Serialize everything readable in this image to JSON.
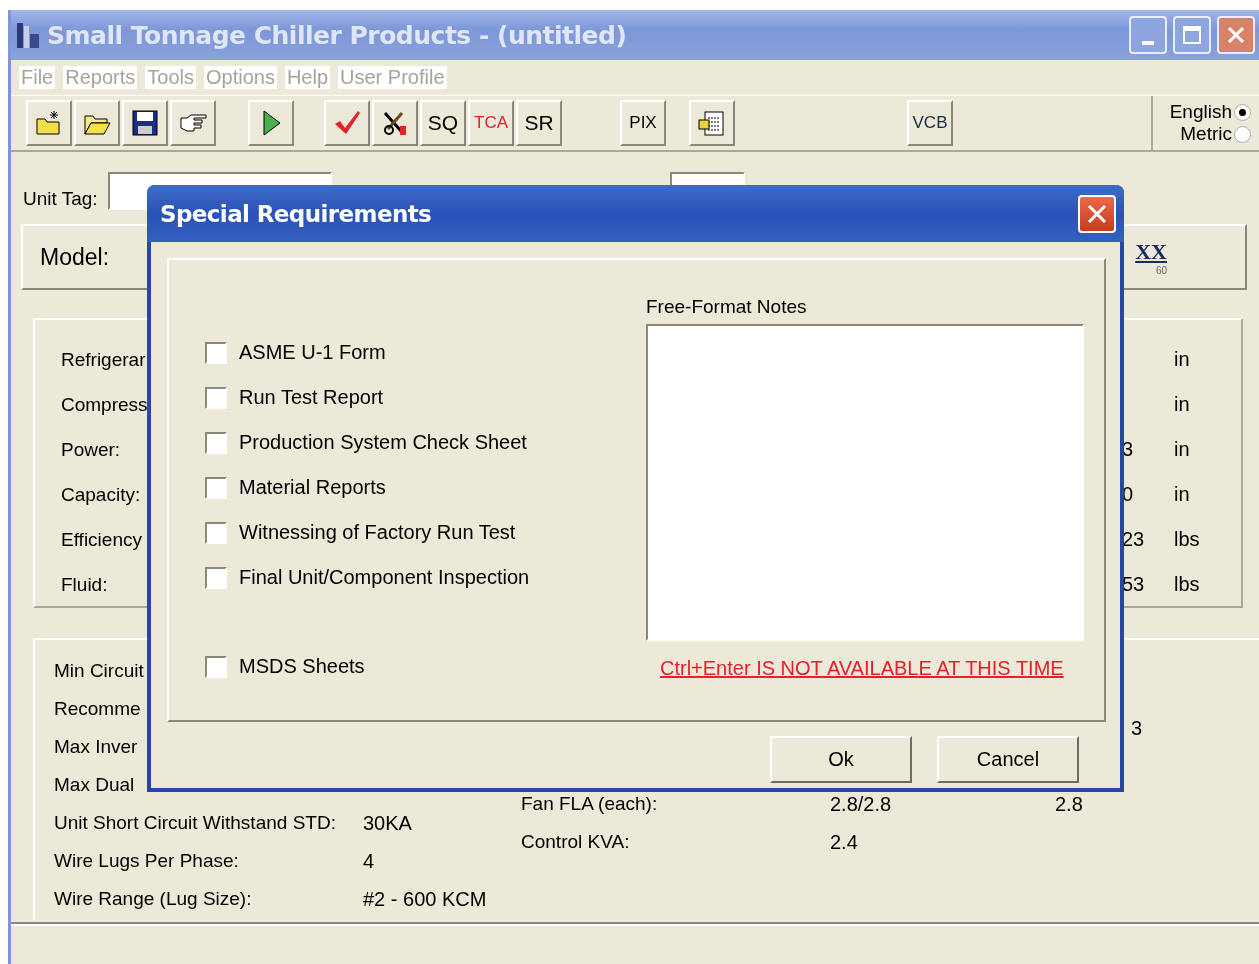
{
  "window": {
    "title": "Small Tonnage Chiller Products - (untitled)"
  },
  "menu": [
    {
      "label": "File",
      "disabled": true
    },
    {
      "label": "Reports",
      "disabled": true
    },
    {
      "label": "Tools",
      "disabled": true
    },
    {
      "label": "Options",
      "disabled": true
    },
    {
      "label": "Help",
      "disabled": true
    },
    {
      "label": "User Profile",
      "disabled": true
    }
  ],
  "toolbar": [
    [
      {
        "kind": "new"
      },
      {
        "kind": "open"
      },
      {
        "kind": "save"
      },
      {
        "kind": "pointer"
      }
    ],
    [
      {
        "kind": "run"
      }
    ],
    [
      {
        "kind": "check"
      },
      {
        "kind": "tools"
      },
      {
        "kind": "text",
        "label": "SQ",
        "color": "#000000"
      },
      {
        "kind": "text",
        "label": "TCA",
        "color": "#e8202a"
      },
      {
        "kind": "text",
        "label": "SR",
        "color": "#000000"
      }
    ],
    [
      {
        "kind": "text",
        "label": "PIX",
        "color": "#000000"
      }
    ],
    [
      {
        "kind": "clipboard"
      }
    ],
    [
      {
        "kind": "text",
        "label": "VCB",
        "color": "#1a2a4a"
      }
    ]
  ],
  "units": [
    {
      "label": "English",
      "selected": true
    },
    {
      "label": "Metric",
      "selected": false
    }
  ],
  "unit_tag": {
    "label": "Unit Tag:"
  },
  "model": {
    "label": "Model:",
    "code": "XX",
    "subscript": "60"
  },
  "performance": [
    {
      "label": "Refrigerar",
      "unit": "in"
    },
    {
      "label": "Compress",
      "unit": "in"
    },
    {
      "label": "Power:",
      "value": "3",
      "unit": "in"
    },
    {
      "label": "Capacity:",
      "value": "0",
      "unit": "in"
    },
    {
      "label": "Efficiency",
      "value": "23",
      "unit": "lbs"
    },
    {
      "label": "Fluid:",
      "value": "53",
      "unit": "lbs"
    }
  ],
  "electrical_left": [
    {
      "label": "Min Circuit"
    },
    {
      "label": "Recomme"
    },
    {
      "label": "Max Inver"
    },
    {
      "label": "Max Dual"
    },
    {
      "label": "Unit Short Circuit Withstand STD:",
      "value": "30KA"
    },
    {
      "label": "Wire Lugs Per Phase:",
      "value": "4"
    },
    {
      "label": "Wire Range (Lug Size):",
      "value": "#2 - 600 KCM"
    }
  ],
  "electrical_right": [
    {
      "value_3": "3"
    },
    {
      "label": "Fan FLA (each):",
      "value": "2.8/2.8",
      "value_2": "2.8"
    },
    {
      "label": "Control KVA:",
      "value": "2.4"
    }
  ],
  "dialog": {
    "title": "Special Requirements",
    "checklist": [
      {
        "label": "ASME U-1 Form",
        "checked": false
      },
      {
        "label": "Run Test Report",
        "checked": false
      },
      {
        "label": "Production System Check Sheet",
        "checked": false
      },
      {
        "label": "Material Reports",
        "checked": false
      },
      {
        "label": "Witnessing of Factory Run Test",
        "checked": false
      },
      {
        "label": "Final Unit/Component Inspection",
        "checked": false
      }
    ],
    "extra_checklist": [
      {
        "label": "MSDS Sheets",
        "checked": false
      }
    ],
    "notes": {
      "label": "Free-Format Notes"
    },
    "warning": "Ctrl+Enter IS NOT AVAILABLE AT THIS TIME",
    "buttons": [
      "Ok",
      "Cancel"
    ]
  }
}
